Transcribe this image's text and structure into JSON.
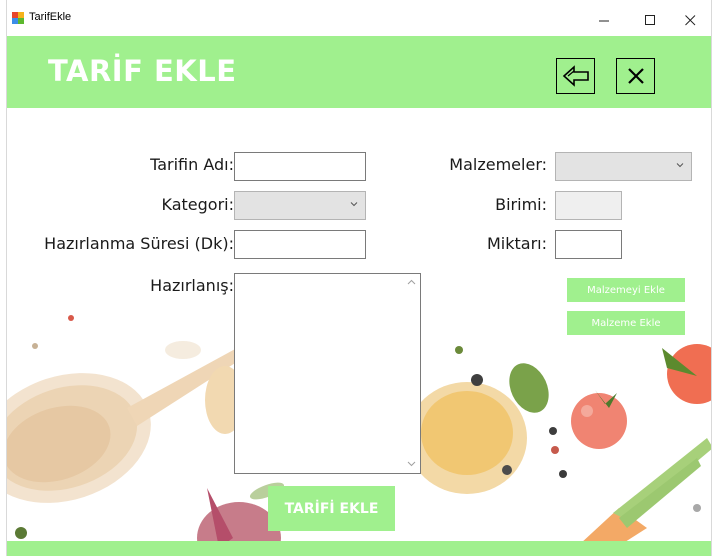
{
  "window": {
    "title": "TarifEkle",
    "minimize_glyph": "—",
    "maximize_glyph": "☐",
    "close_glyph": "✕"
  },
  "header": {
    "title": "TARİF EKLE",
    "back_icon": "back-arrow-icon",
    "close_icon": "close-icon",
    "color": "#a0f08e"
  },
  "form": {
    "recipe_name_label": "Tarifin Adı:",
    "recipe_name_value": "",
    "category_label": "Kategori:",
    "category_value": "",
    "prep_time_label": "Hazırlanma Süresi (Dk):",
    "prep_time_value": "",
    "preparation_label": "Hazırlanış:",
    "preparation_value": "",
    "ingredients_label": "Malzemeler:",
    "ingredients_value": "",
    "unit_label": "Birimi:",
    "unit_value": "",
    "amount_label": "Miktarı:",
    "amount_value": ""
  },
  "buttons": {
    "add_ingredient_to_recipe": "Malzemeyi Ekle",
    "add_ingredient": "Malzeme Ekle",
    "add_recipe": "TARİFİ EKLE"
  }
}
